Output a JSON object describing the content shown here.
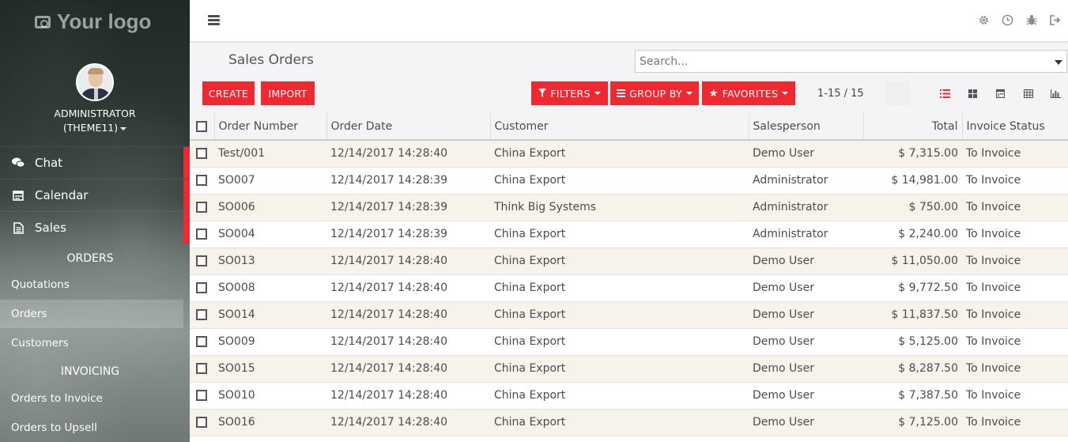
{
  "sidebar": {
    "logo": "Your logo",
    "user": {
      "name": "ADMINISTRATOR",
      "db": "(THEME11)"
    },
    "menu": [
      {
        "label": "Chat",
        "icon": "chat-icon"
      },
      {
        "label": "Calendar",
        "icon": "calendar-icon"
      },
      {
        "label": "Sales",
        "icon": "document-icon"
      }
    ],
    "sections": [
      {
        "title": "ORDERS",
        "items": [
          "Quotations",
          "Orders",
          "Customers"
        ]
      },
      {
        "title": "INVOICING",
        "items": [
          "Orders to Invoice",
          "Orders to Upsell"
        ]
      }
    ],
    "selected_item": "Orders",
    "accent": "#f02930"
  },
  "topbar": {
    "icons": [
      "gear-icon",
      "clock-icon",
      "bug-icon",
      "logout-icon"
    ]
  },
  "control_panel": {
    "title": "Sales Orders",
    "search_placeholder": "Search...",
    "create": "CREATE",
    "import": "IMPORT",
    "filters": "FILTERS",
    "group_by": "GROUP BY",
    "favorites": "FAVORITES",
    "pager": "1-15 / 15",
    "views": [
      "list-view-icon",
      "kanban-view-icon",
      "calendar-view-icon",
      "pivot-view-icon",
      "graph-view-icon"
    ],
    "active_view": "list-view-icon"
  },
  "table": {
    "columns": [
      "Order Number",
      "Order Date",
      "Customer",
      "Salesperson",
      "Total",
      "Invoice Status"
    ],
    "rows": [
      [
        "Test/001",
        "12/14/2017 14:28:40",
        "China Export",
        "Demo User",
        "$ 7,315.00",
        "To Invoice"
      ],
      [
        "SO007",
        "12/14/2017 14:28:39",
        "China Export",
        "Administrator",
        "$ 14,981.00",
        "To Invoice"
      ],
      [
        "SO006",
        "12/14/2017 14:28:39",
        "Think Big Systems",
        "Administrator",
        "$ 750.00",
        "To Invoice"
      ],
      [
        "SO004",
        "12/14/2017 14:28:39",
        "China Export",
        "Administrator",
        "$ 2,240.00",
        "To Invoice"
      ],
      [
        "SO013",
        "12/14/2017 14:28:40",
        "China Export",
        "Demo User",
        "$ 11,050.00",
        "To Invoice"
      ],
      [
        "SO008",
        "12/14/2017 14:28:40",
        "China Export",
        "Demo User",
        "$ 9,772.50",
        "To Invoice"
      ],
      [
        "SO014",
        "12/14/2017 14:28:40",
        "China Export",
        "Demo User",
        "$ 11,837.50",
        "To Invoice"
      ],
      [
        "SO009",
        "12/14/2017 14:28:40",
        "China Export",
        "Demo User",
        "$ 5,125.00",
        "To Invoice"
      ],
      [
        "SO015",
        "12/14/2017 14:28:40",
        "China Export",
        "Demo User",
        "$ 8,287.50",
        "To Invoice"
      ],
      [
        "SO010",
        "12/14/2017 14:28:40",
        "China Export",
        "Demo User",
        "$ 7,387.50",
        "To Invoice"
      ],
      [
        "SO016",
        "12/14/2017 14:28:40",
        "China Export",
        "Demo User",
        "$ 7,125.00",
        "To Invoice"
      ]
    ]
  }
}
